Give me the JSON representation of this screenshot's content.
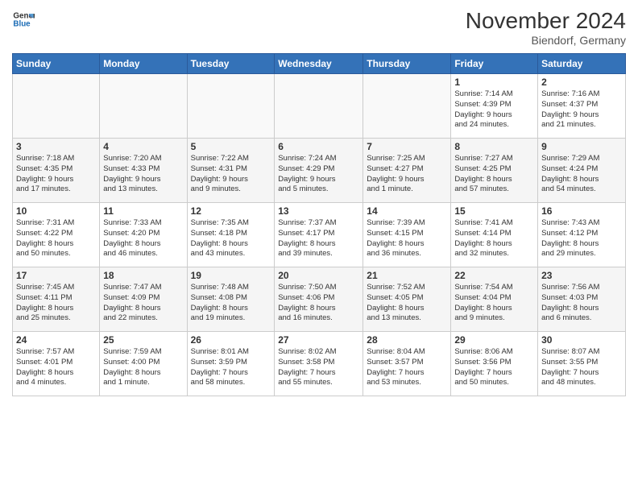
{
  "logo": {
    "line1": "General",
    "line2": "Blue"
  },
  "title": "November 2024",
  "location": "Biendorf, Germany",
  "weekdays": [
    "Sunday",
    "Monday",
    "Tuesday",
    "Wednesday",
    "Thursday",
    "Friday",
    "Saturday"
  ],
  "weeks": [
    [
      {
        "day": "",
        "info": ""
      },
      {
        "day": "",
        "info": ""
      },
      {
        "day": "",
        "info": ""
      },
      {
        "day": "",
        "info": ""
      },
      {
        "day": "",
        "info": ""
      },
      {
        "day": "1",
        "info": "Sunrise: 7:14 AM\nSunset: 4:39 PM\nDaylight: 9 hours\nand 24 minutes."
      },
      {
        "day": "2",
        "info": "Sunrise: 7:16 AM\nSunset: 4:37 PM\nDaylight: 9 hours\nand 21 minutes."
      }
    ],
    [
      {
        "day": "3",
        "info": "Sunrise: 7:18 AM\nSunset: 4:35 PM\nDaylight: 9 hours\nand 17 minutes."
      },
      {
        "day": "4",
        "info": "Sunrise: 7:20 AM\nSunset: 4:33 PM\nDaylight: 9 hours\nand 13 minutes."
      },
      {
        "day": "5",
        "info": "Sunrise: 7:22 AM\nSunset: 4:31 PM\nDaylight: 9 hours\nand 9 minutes."
      },
      {
        "day": "6",
        "info": "Sunrise: 7:24 AM\nSunset: 4:29 PM\nDaylight: 9 hours\nand 5 minutes."
      },
      {
        "day": "7",
        "info": "Sunrise: 7:25 AM\nSunset: 4:27 PM\nDaylight: 9 hours\nand 1 minute."
      },
      {
        "day": "8",
        "info": "Sunrise: 7:27 AM\nSunset: 4:25 PM\nDaylight: 8 hours\nand 57 minutes."
      },
      {
        "day": "9",
        "info": "Sunrise: 7:29 AM\nSunset: 4:24 PM\nDaylight: 8 hours\nand 54 minutes."
      }
    ],
    [
      {
        "day": "10",
        "info": "Sunrise: 7:31 AM\nSunset: 4:22 PM\nDaylight: 8 hours\nand 50 minutes."
      },
      {
        "day": "11",
        "info": "Sunrise: 7:33 AM\nSunset: 4:20 PM\nDaylight: 8 hours\nand 46 minutes."
      },
      {
        "day": "12",
        "info": "Sunrise: 7:35 AM\nSunset: 4:18 PM\nDaylight: 8 hours\nand 43 minutes."
      },
      {
        "day": "13",
        "info": "Sunrise: 7:37 AM\nSunset: 4:17 PM\nDaylight: 8 hours\nand 39 minutes."
      },
      {
        "day": "14",
        "info": "Sunrise: 7:39 AM\nSunset: 4:15 PM\nDaylight: 8 hours\nand 36 minutes."
      },
      {
        "day": "15",
        "info": "Sunrise: 7:41 AM\nSunset: 4:14 PM\nDaylight: 8 hours\nand 32 minutes."
      },
      {
        "day": "16",
        "info": "Sunrise: 7:43 AM\nSunset: 4:12 PM\nDaylight: 8 hours\nand 29 minutes."
      }
    ],
    [
      {
        "day": "17",
        "info": "Sunrise: 7:45 AM\nSunset: 4:11 PM\nDaylight: 8 hours\nand 25 minutes."
      },
      {
        "day": "18",
        "info": "Sunrise: 7:47 AM\nSunset: 4:09 PM\nDaylight: 8 hours\nand 22 minutes."
      },
      {
        "day": "19",
        "info": "Sunrise: 7:48 AM\nSunset: 4:08 PM\nDaylight: 8 hours\nand 19 minutes."
      },
      {
        "day": "20",
        "info": "Sunrise: 7:50 AM\nSunset: 4:06 PM\nDaylight: 8 hours\nand 16 minutes."
      },
      {
        "day": "21",
        "info": "Sunrise: 7:52 AM\nSunset: 4:05 PM\nDaylight: 8 hours\nand 13 minutes."
      },
      {
        "day": "22",
        "info": "Sunrise: 7:54 AM\nSunset: 4:04 PM\nDaylight: 8 hours\nand 9 minutes."
      },
      {
        "day": "23",
        "info": "Sunrise: 7:56 AM\nSunset: 4:03 PM\nDaylight: 8 hours\nand 6 minutes."
      }
    ],
    [
      {
        "day": "24",
        "info": "Sunrise: 7:57 AM\nSunset: 4:01 PM\nDaylight: 8 hours\nand 4 minutes."
      },
      {
        "day": "25",
        "info": "Sunrise: 7:59 AM\nSunset: 4:00 PM\nDaylight: 8 hours\nand 1 minute."
      },
      {
        "day": "26",
        "info": "Sunrise: 8:01 AM\nSunset: 3:59 PM\nDaylight: 7 hours\nand 58 minutes."
      },
      {
        "day": "27",
        "info": "Sunrise: 8:02 AM\nSunset: 3:58 PM\nDaylight: 7 hours\nand 55 minutes."
      },
      {
        "day": "28",
        "info": "Sunrise: 8:04 AM\nSunset: 3:57 PM\nDaylight: 7 hours\nand 53 minutes."
      },
      {
        "day": "29",
        "info": "Sunrise: 8:06 AM\nSunset: 3:56 PM\nDaylight: 7 hours\nand 50 minutes."
      },
      {
        "day": "30",
        "info": "Sunrise: 8:07 AM\nSunset: 3:55 PM\nDaylight: 7 hours\nand 48 minutes."
      }
    ]
  ]
}
